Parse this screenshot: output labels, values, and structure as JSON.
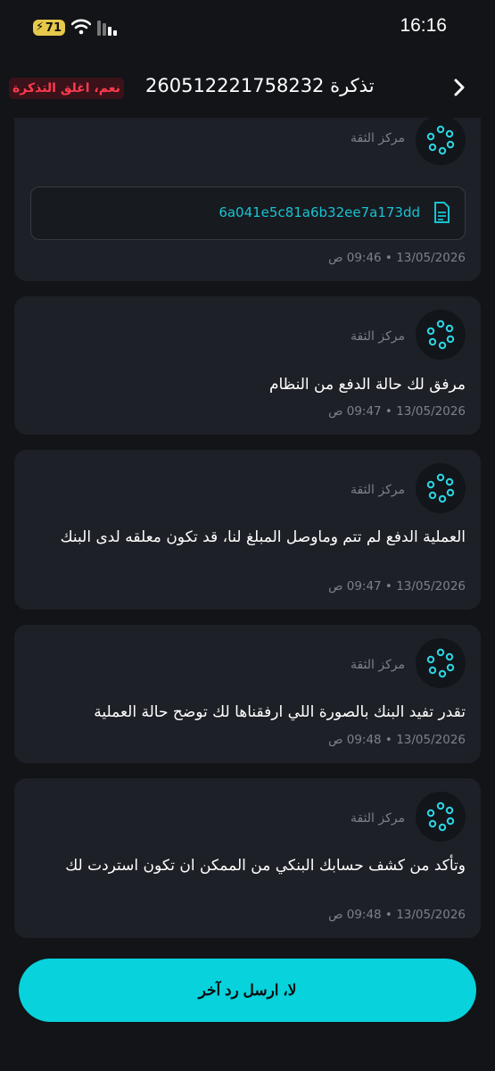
{
  "status_bar": {
    "battery": "71",
    "time": "16:16"
  },
  "header": {
    "title": "تذكرة 260512221758232",
    "close_ticket_label": "نعم، اغلق التذكرة"
  },
  "messages": [
    {
      "sender": "مركز الثقة",
      "file_name": "6a041e5c81a6b32ee7a173dd",
      "time": "13/05/2026 • 09:46 ص"
    },
    {
      "sender": "مركز الثقة",
      "text": "مرفق لك حالة الدفع من النظام",
      "time": "13/05/2026 • 09:47 ص"
    },
    {
      "sender": "مركز الثقة",
      "text": "العملية الدفع لم تتم وماوصل المبلغ لنا، قد تكون معلقه لدى البنك",
      "time": "13/05/2026 • 09:47 ص"
    },
    {
      "sender": "مركز الثقة",
      "text": "تقدر تفيد البنك بالصورة اللي ارفقناها لك توضح حالة العملية",
      "time": "13/05/2026 • 09:48 ص"
    },
    {
      "sender": "مركز الثقة",
      "text": "وتأكد من كشف حسابك البنكي من الممكن ان تكون استردت لك",
      "time": "13/05/2026 • 09:48 ص"
    }
  ],
  "footer": {
    "reply_label": "لا، ارسل رد آخر"
  },
  "colors": {
    "accent": "#08d2db",
    "danger": "#ff3b4e",
    "background": "#121418",
    "card": "#1d2026"
  },
  "icons": [
    "wifi-icon",
    "signal-icon",
    "back-chevron-icon",
    "avatar-logo-icon",
    "file-icon"
  ]
}
